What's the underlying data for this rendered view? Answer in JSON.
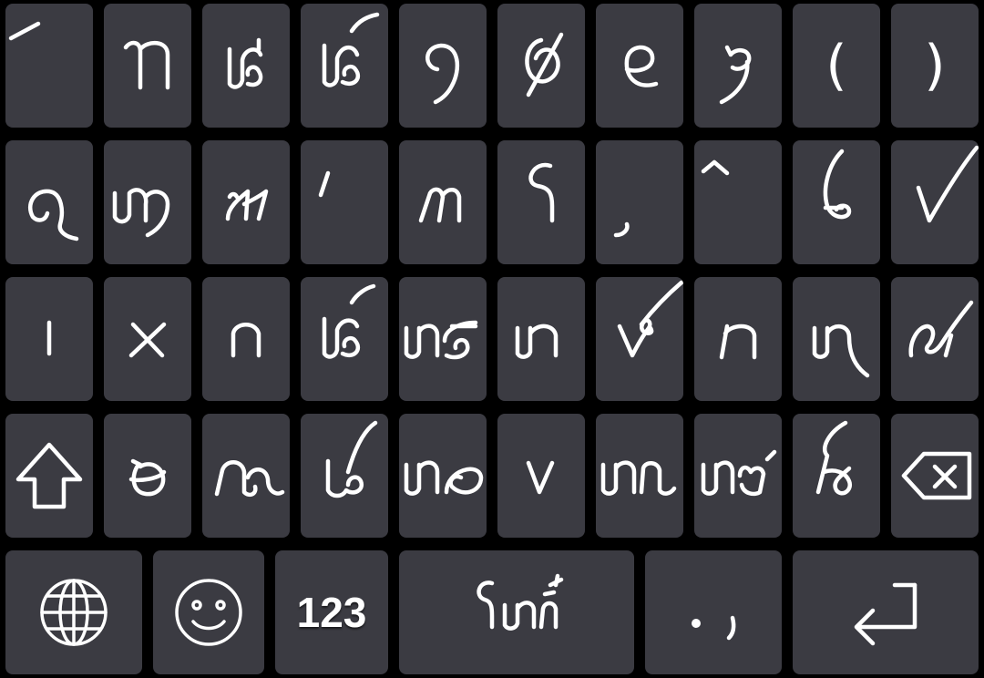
{
  "keyboard": {
    "colors": {
      "background": "#000000",
      "key": "#3b3b42",
      "glyph": "#ffffff"
    },
    "rows": [
      {
        "keys": [
          {
            "name": "key-r1-c1",
            "glyph": "accent-mark-glyph"
          },
          {
            "name": "key-r1-c2",
            "glyph": "script-letter-glyph"
          },
          {
            "name": "key-r1-c3",
            "glyph": "script-letter-glyph"
          },
          {
            "name": "key-r1-c4",
            "glyph": "script-letter-glyph"
          },
          {
            "name": "key-r1-c5",
            "glyph": "script-numeral-glyph"
          },
          {
            "name": "key-r1-c6",
            "glyph": "script-numeral-glyph"
          },
          {
            "name": "key-r1-c7",
            "glyph": "script-numeral-glyph"
          },
          {
            "name": "key-r1-c8",
            "glyph": "script-numeral-glyph"
          },
          {
            "name": "key-r1-c9",
            "text": "("
          },
          {
            "name": "key-r1-c10",
            "text": ")"
          }
        ]
      },
      {
        "keys": [
          {
            "name": "key-r2-c1",
            "glyph": "script-letter-glyph"
          },
          {
            "name": "key-r2-c2",
            "glyph": "script-letter-glyph"
          },
          {
            "name": "key-r2-c3",
            "glyph": "script-letter-glyph"
          },
          {
            "name": "key-r2-c4",
            "glyph": "accent-mark-glyph"
          },
          {
            "name": "key-r2-c5",
            "glyph": "script-letter-glyph"
          },
          {
            "name": "key-r2-c6",
            "glyph": "script-letter-glyph"
          },
          {
            "name": "key-r2-c7",
            "glyph": "script-mark-glyph"
          },
          {
            "name": "key-r2-c8",
            "glyph": "script-mark-glyph"
          },
          {
            "name": "key-r2-c9",
            "glyph": "script-letter-glyph"
          },
          {
            "name": "key-r2-c10",
            "glyph": "checkmark-glyph"
          }
        ]
      },
      {
        "keys": [
          {
            "name": "key-r3-c1",
            "glyph": "script-letter-glyph"
          },
          {
            "name": "key-r3-c2",
            "glyph": "script-letter-glyph"
          },
          {
            "name": "key-r3-c3",
            "glyph": "script-letter-glyph"
          },
          {
            "name": "key-r3-c4",
            "glyph": "script-letter-glyph"
          },
          {
            "name": "key-r3-c5",
            "glyph": "script-letter-glyph"
          },
          {
            "name": "key-r3-c6",
            "glyph": "script-letter-glyph"
          },
          {
            "name": "key-r3-c7",
            "glyph": "script-letter-glyph"
          },
          {
            "name": "key-r3-c8",
            "glyph": "script-letter-glyph"
          },
          {
            "name": "key-r3-c9",
            "glyph": "script-letter-glyph"
          },
          {
            "name": "key-r3-c10",
            "glyph": "script-letter-glyph"
          }
        ]
      },
      {
        "keys": [
          {
            "name": "shift-key",
            "glyph": "shift-arrow-icon"
          },
          {
            "name": "key-r4-c2",
            "glyph": "script-letter-glyph"
          },
          {
            "name": "key-r4-c3",
            "glyph": "script-letter-glyph"
          },
          {
            "name": "key-r4-c4",
            "glyph": "script-letter-glyph"
          },
          {
            "name": "key-r4-c5",
            "glyph": "script-letter-glyph"
          },
          {
            "name": "key-r4-c6",
            "glyph": "script-letter-glyph"
          },
          {
            "name": "key-r4-c7",
            "glyph": "script-letter-glyph"
          },
          {
            "name": "key-r4-c8",
            "glyph": "script-letter-glyph"
          },
          {
            "name": "key-r4-c9",
            "glyph": "script-letter-glyph"
          },
          {
            "name": "backspace-key",
            "glyph": "backspace-icon"
          }
        ]
      },
      {
        "keys": [
          {
            "name": "language-key",
            "glyph": "globe-icon"
          },
          {
            "name": "emoji-key",
            "glyph": "smiley-icon"
          },
          {
            "name": "numbers-key",
            "text": "123"
          },
          {
            "name": "space-key",
            "glyph": "script-word-glyph"
          },
          {
            "name": "punctuation-key",
            "text": ". ,"
          },
          {
            "name": "enter-key",
            "glyph": "return-arrow-icon"
          }
        ]
      }
    ]
  }
}
